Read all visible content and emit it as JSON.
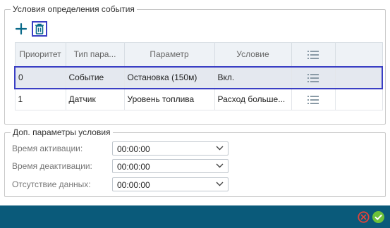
{
  "conditions": {
    "legend": "Условия определения события",
    "columns": [
      "Приоритет",
      "Тип пара...",
      "Параметр",
      "Условие",
      "",
      ""
    ],
    "rows": [
      {
        "priority": "0",
        "type": "Событие",
        "parameter": "Остановка (150м)",
        "condition": "Вкл.",
        "selected": true
      },
      {
        "priority": "1",
        "type": "Датчик",
        "parameter": "Уровень топлива",
        "condition": "Расход больше...",
        "selected": false
      }
    ]
  },
  "extra": {
    "legend": "Доп. параметры условия",
    "activation_label": "Время активации:",
    "activation_value": "00:00:00",
    "deactivation_label": "Время деактивации:",
    "deactivation_value": "00:00:00",
    "nodata_label": "Отсутствие данных:",
    "nodata_value": "00:00:00"
  },
  "icons": {
    "add": "plus-icon",
    "delete": "trash-icon",
    "columns": "column-list-icon",
    "dropdown": "chevron-down-icon",
    "cancel": "cancel-circle-icon",
    "ok": "check-circle-icon"
  },
  "colors": {
    "accent": "#3a3fc4",
    "footer": "#0a5a7a",
    "ok": "#6cc23a",
    "cancel": "#e0443a",
    "icon": "#0a6a8a"
  }
}
